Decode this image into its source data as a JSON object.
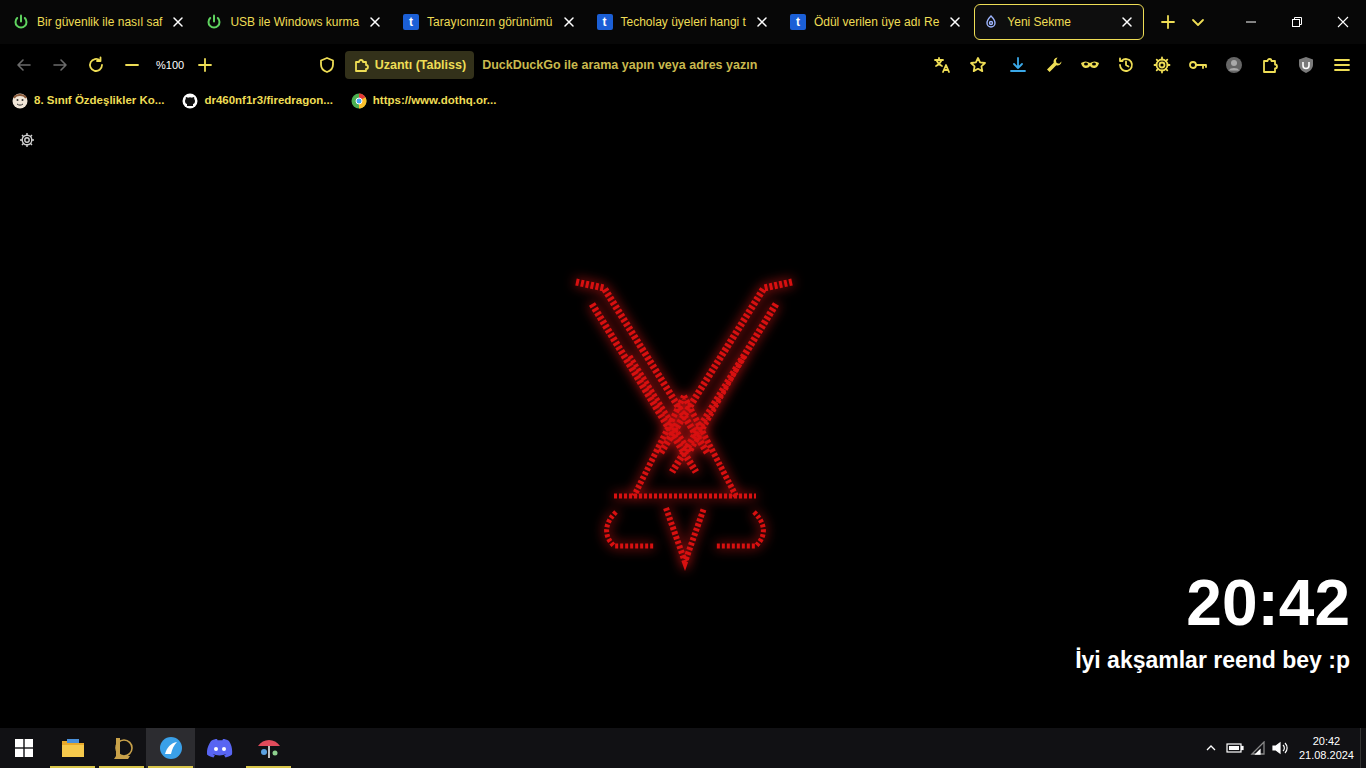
{
  "tabs": [
    {
      "label": "Bir güvenlik ile nasıl saf",
      "kind": "power",
      "selected": false
    },
    {
      "label": "USB ile Windows kurma",
      "kind": "power",
      "selected": false
    },
    {
      "label": "Tarayıcınızın görünümü",
      "kind": "techolay",
      "icon_text": "t",
      "selected": false
    },
    {
      "label": "Techolay üyeleri hangi t",
      "kind": "techolay",
      "icon_text": "t",
      "selected": false
    },
    {
      "label": "Ödül verilen üye adı Re",
      "kind": "techolay",
      "icon_text": "t",
      "selected": false
    },
    {
      "label": "Yeni Sekme",
      "kind": "tabliss",
      "selected": true
    }
  ],
  "toolbar": {
    "zoom": "%100",
    "identity": "Uzantı (Tabliss)",
    "url_placeholder": "DuckDuckGo ile arama yapın veya adres yazın"
  },
  "bookmarks": [
    {
      "label": "8. Sınıf Özdeşlikler Ko...",
      "kind": "avatar"
    },
    {
      "label": "dr460nf1r3/firedragon...",
      "kind": "github"
    },
    {
      "label": "https://www.dothq.or...",
      "kind": "globe"
    }
  ],
  "newtab": {
    "clock": "20:42",
    "greeting": "İyi akşamlar reend bey :p"
  },
  "taskbar": {
    "apps": [
      {
        "kind": "explorer",
        "running": true,
        "selected": false
      },
      {
        "kind": "league",
        "running": true,
        "selected": false
      },
      {
        "kind": "floorp",
        "running": true,
        "selected": true
      },
      {
        "kind": "discord",
        "running": false,
        "selected": false
      },
      {
        "kind": "other",
        "running": true,
        "selected": false
      }
    ],
    "tray": {
      "time": "20:42",
      "date": "21.08.2024"
    }
  }
}
